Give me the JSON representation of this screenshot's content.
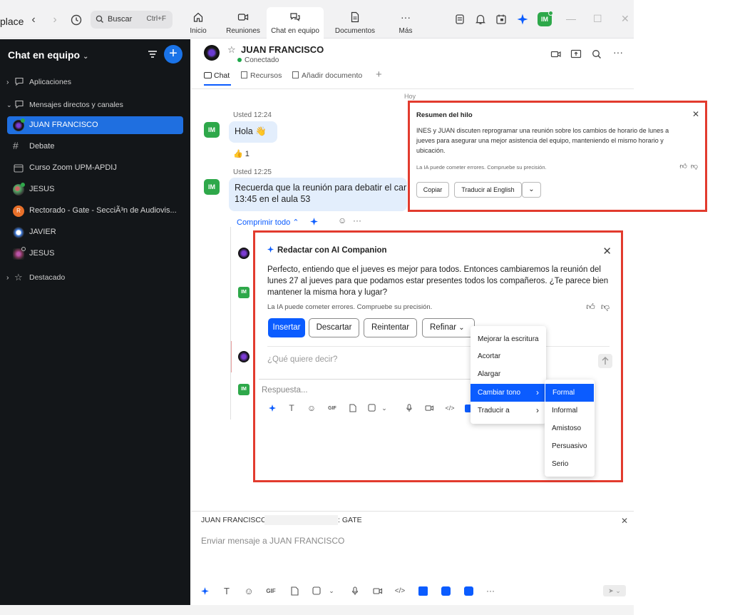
{
  "app": {
    "name_partial": "place",
    "search_label": "Buscar",
    "search_shortcut": "Ctrl+F",
    "tabs": [
      {
        "label": "Inicio",
        "icon": "home-icon"
      },
      {
        "label": "Reuniones",
        "icon": "video-camera-icon"
      },
      {
        "label": "Chat en equipo",
        "icon": "chat-bubbles-icon",
        "active": true
      },
      {
        "label": "Documentos",
        "icon": "document-icon"
      },
      {
        "label": "Más",
        "icon": "ellipsis-icon"
      }
    ],
    "user_initials": "IM",
    "colors": {
      "accent": "#0b5cff",
      "sidebar_bg": "#131619",
      "selected": "#1f6fe0",
      "highlight_border": "#e23b2e",
      "avatar_green": "#2ea84a",
      "bubble": "#e3eefc"
    }
  },
  "sidebar": {
    "title": "Chat en equipo",
    "sections": [
      {
        "label": "Aplicaciones",
        "icon": "chat-icon"
      },
      {
        "label": "Mensajes directos y canales",
        "icon": "chat-icon"
      },
      {
        "label": "Destacado",
        "icon": "star-icon"
      }
    ],
    "items": [
      {
        "label": "JUAN FRANCISCO",
        "selected": true
      },
      {
        "label": "Debate",
        "icon": "hash-icon"
      },
      {
        "label": "Curso Zoom UPM-APDIJ",
        "icon": "folder-icon"
      },
      {
        "label": "JESUS"
      },
      {
        "label": "Rectorado - Gate - SecciÃ³n de Audiovis..."
      },
      {
        "label": "JAVIER"
      },
      {
        "label": "JESUS"
      }
    ]
  },
  "chat": {
    "contact_name": "JUAN FRANCISCO",
    "status": "Conectado",
    "tabs": [
      "Chat",
      "Recursos",
      "Añadir documento"
    ],
    "day_label": "Hoy",
    "messages": [
      {
        "author_time": "Usted 12:24",
        "text": "Hola 👋",
        "reaction": "👍",
        "reaction_count": "1"
      },
      {
        "author_time": "Usted 12:25",
        "line1": "Recuerda que la reunión para debatir el car",
        "line2": "13:45 en el aula 53"
      }
    ],
    "thread_collapse": "Comprimir todo"
  },
  "summary": {
    "title": "Resumen del hilo",
    "body": "INES y JUAN discuten reprogramar una reunión sobre los cambios de horario de lunes a jueves para asegurar una mejor asistencia del equipo, manteniendo el mismo horario y ubicación.",
    "disclaimer": "La IA puede cometer errores. Compruebe su precisión.",
    "copy_label": "Copiar",
    "translate_label": "Traducir al English"
  },
  "ai_companion": {
    "title": "Redactar con AI Companion",
    "body": "Perfecto, entiendo que el jueves es mejor para todos. Entonces cambiaremos la reunión del lunes 27 al jueves para que podamos estar presentes todos los compañeros. ¿Te parece bien mantener la misma hora y lugar?",
    "disclaimer": "La IA puede cometer errores. Compruebe su precisión.",
    "buttons": {
      "insert": "Insertar",
      "discard": "Descartar",
      "retry": "Reintentar",
      "refine": "Refinar"
    },
    "input_placeholder": "¿Qué quiere decir?",
    "reply_placeholder": "Respuesta..."
  },
  "refine_menu": {
    "items": [
      "Mejorar la escritura",
      "Acortar",
      "Alargar",
      "Cambiar tono",
      "Traducir a"
    ],
    "selected": "Cambiar tono"
  },
  "tone_menu": {
    "items": [
      "Formal",
      "Informal",
      "Amistoso",
      "Persuasivo",
      "Serio"
    ],
    "selected": "Formal"
  },
  "composer": {
    "context_name": "JUAN FRANCISCO",
    "context_suffix": ": GATE",
    "placeholder": "Enviar mensaje a JUAN FRANCISCO"
  }
}
